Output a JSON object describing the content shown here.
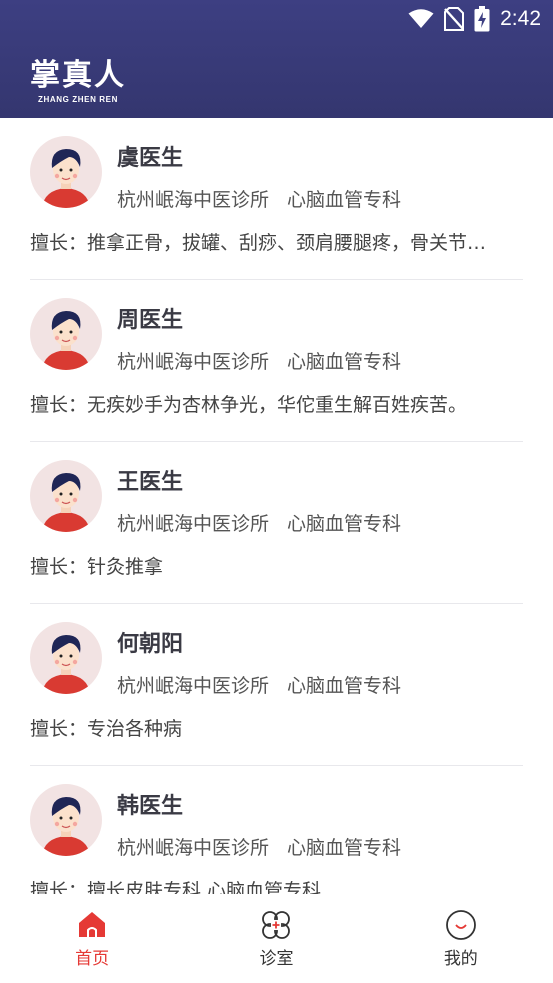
{
  "status_bar": {
    "time": "2:42",
    "icons": [
      "wifi-icon",
      "no-sim-icon",
      "battery-charging-icon"
    ]
  },
  "header": {
    "logo_cn": "掌真人",
    "logo_en": "ZHANG ZHEN REN"
  },
  "doctors": [
    {
      "name": "虞医生",
      "clinic": "杭州岷海中医诊所",
      "dept": "心脑血管专科",
      "skill": "擅长：推拿正骨，拔罐、刮痧、颈肩腰腿疼，骨关节…"
    },
    {
      "name": "周医生",
      "clinic": "杭州岷海中医诊所",
      "dept": "心脑血管专科",
      "skill": "擅长：无疾妙手为杏林争光，华佗重生解百姓疾苦。"
    },
    {
      "name": "王医生",
      "clinic": "杭州岷海中医诊所",
      "dept": "心脑血管专科",
      "skill": "擅长：针灸推拿"
    },
    {
      "name": "何朝阳",
      "clinic": "杭州岷海中医诊所",
      "dept": "心脑血管专科",
      "skill": "擅长：专治各种病"
    },
    {
      "name": "韩医生",
      "clinic": "杭州岷海中医诊所",
      "dept": "心脑血管专科",
      "skill": "擅长：擅长皮肤专科 心脑血管专科"
    }
  ],
  "tabs": [
    {
      "label": "首页",
      "icon": "home-icon",
      "active": true
    },
    {
      "label": "诊室",
      "icon": "clinic-icon",
      "active": false
    },
    {
      "label": "我的",
      "icon": "profile-smile-icon",
      "active": false
    }
  ],
  "colors": {
    "header": "#3d3f82",
    "accent": "#e53935"
  }
}
